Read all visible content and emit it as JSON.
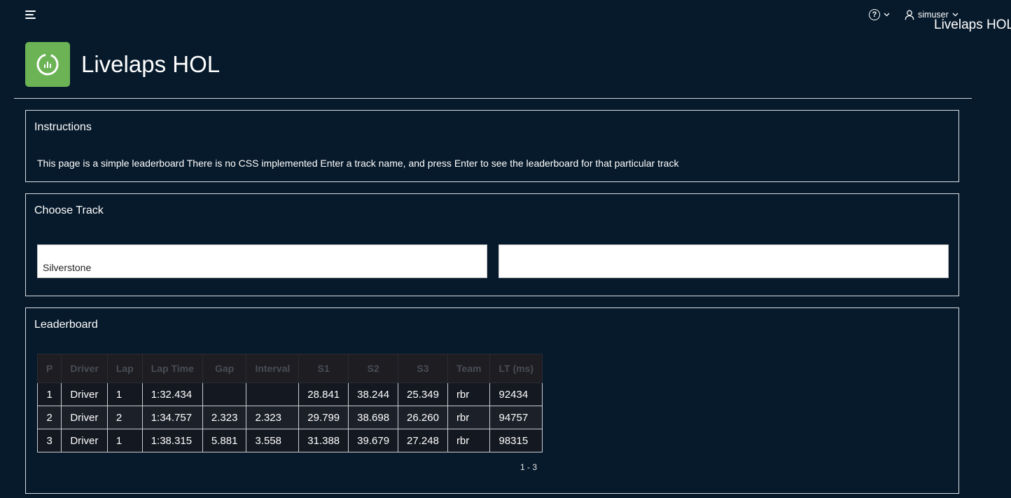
{
  "header": {
    "help_icon": "help-circle-icon",
    "user_name": "simuser",
    "floating_title": "Livelaps HOL"
  },
  "app": {
    "title": "Livelaps HOL",
    "icon": "timer-chart-icon",
    "accent_color": "#6cb356"
  },
  "instructions": {
    "title": "Instructions",
    "text": "This page is a simple leaderboard There is no CSS implemented Enter a track name, and press Enter to see the leaderboard for that particular track"
  },
  "choose_track": {
    "title": "Choose Track",
    "track_value": "Silverstone",
    "second_value": ""
  },
  "leaderboard": {
    "title": "Leaderboard",
    "columns": [
      "P",
      "Driver",
      "Lap",
      "Lap Time",
      "Gap",
      "Interval",
      "S1",
      "S2",
      "S3",
      "Team",
      "LT (ms)"
    ],
    "rows": [
      [
        "1",
        "Driver",
        "1",
        "1:32.434",
        "",
        "",
        "28.841",
        "38.244",
        "25.349",
        "rbr",
        "92434"
      ],
      [
        "2",
        "Driver",
        "2",
        "1:34.757",
        "2.323",
        "2.323",
        "29.799",
        "38.698",
        "26.260",
        "rbr",
        "94757"
      ],
      [
        "3",
        "Driver",
        "1",
        "1:38.315",
        "5.881",
        "3.558",
        "31.388",
        "39.679",
        "27.248",
        "rbr",
        "98315"
      ]
    ],
    "pagination": "1 - 3"
  }
}
